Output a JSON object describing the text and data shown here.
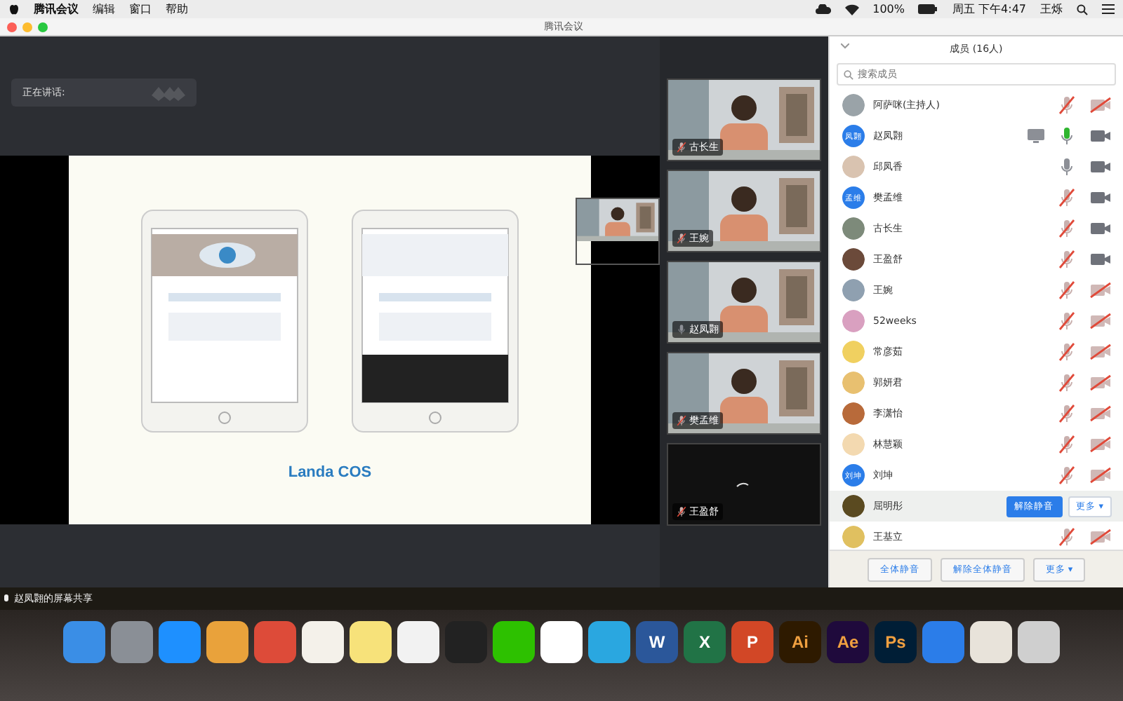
{
  "menu_bar": {
    "app": "腾讯会议",
    "items": [
      "编辑",
      "窗口",
      "帮助"
    ],
    "battery": "100%",
    "clock": "周五 下午4:47",
    "user": "王烁"
  },
  "window": {
    "title": "腾讯会议"
  },
  "speaking": {
    "label": "正在讲话:"
  },
  "slide": {
    "title": "Landa COS"
  },
  "videos": [
    {
      "name": "古长生",
      "muted": true
    },
    {
      "name": "王婉",
      "muted": true
    },
    {
      "name": "赵凤翾",
      "muted": false
    },
    {
      "name": "樊孟维",
      "muted": true
    },
    {
      "name": "王盈舒",
      "muted": true
    }
  ],
  "share_status": "赵凤翾的屏幕共享",
  "panel": {
    "title": "成员 (16人)",
    "search": {
      "placeholder": "搜索成员"
    },
    "members": [
      {
        "name": "阿萨咪(主持人)",
        "avatar": {
          "kind": "picture",
          "color": "#9aa3a8"
        },
        "sharing": false,
        "muted": true,
        "speaking": false,
        "camera": false,
        "selected": false
      },
      {
        "name": "赵凤翾",
        "avatar": {
          "kind": "text",
          "text": "凤翾",
          "color": "#2b7de9"
        },
        "sharing": true,
        "muted": false,
        "speaking": true,
        "camera": true,
        "selected": false
      },
      {
        "name": "邱凤香",
        "avatar": {
          "kind": "picture",
          "color": "#d9c3b0"
        },
        "sharing": false,
        "muted": false,
        "speaking": false,
        "camera": true,
        "selected": false
      },
      {
        "name": "樊孟维",
        "avatar": {
          "kind": "text",
          "text": "孟维",
          "color": "#2b7de9"
        },
        "sharing": false,
        "muted": true,
        "speaking": false,
        "camera": true,
        "selected": false
      },
      {
        "name": "古长生",
        "avatar": {
          "kind": "picture",
          "color": "#7d8a7a"
        },
        "sharing": false,
        "muted": true,
        "speaking": false,
        "camera": true,
        "selected": false
      },
      {
        "name": "王盈舒",
        "avatar": {
          "kind": "picture",
          "color": "#6b4a3a"
        },
        "sharing": false,
        "muted": true,
        "speaking": false,
        "camera": true,
        "selected": false
      },
      {
        "name": "王婉",
        "avatar": {
          "kind": "picture",
          "color": "#8fa0b0"
        },
        "sharing": false,
        "muted": true,
        "speaking": false,
        "camera": false,
        "selected": false
      },
      {
        "name": "52weeks",
        "avatar": {
          "kind": "picture",
          "color": "#d9a0c0"
        },
        "sharing": false,
        "muted": true,
        "speaking": false,
        "camera": false,
        "selected": false
      },
      {
        "name": "常彦茹",
        "avatar": {
          "kind": "picture",
          "color": "#f0d060"
        },
        "sharing": false,
        "muted": true,
        "speaking": false,
        "camera": false,
        "selected": false
      },
      {
        "name": "郭妍君",
        "avatar": {
          "kind": "picture",
          "color": "#e8c070"
        },
        "sharing": false,
        "muted": true,
        "speaking": false,
        "camera": false,
        "selected": false
      },
      {
        "name": "李潇怡",
        "avatar": {
          "kind": "picture",
          "color": "#b86a3a"
        },
        "sharing": false,
        "muted": true,
        "speaking": false,
        "camera": false,
        "selected": false
      },
      {
        "name": "林慧颖",
        "avatar": {
          "kind": "picture",
          "color": "#f3d9b0"
        },
        "sharing": false,
        "muted": true,
        "speaking": false,
        "camera": false,
        "selected": false
      },
      {
        "name": "刘坤",
        "avatar": {
          "kind": "text",
          "text": "刘坤",
          "color": "#2b7de9"
        },
        "sharing": false,
        "muted": true,
        "speaking": false,
        "camera": false,
        "selected": false
      },
      {
        "name": "屈明彤",
        "avatar": {
          "kind": "picture",
          "color": "#5a4a20"
        },
        "selected": true,
        "actions": [
          "解除静音",
          "更多 ▾"
        ]
      },
      {
        "name": "王基立",
        "avatar": {
          "kind": "picture",
          "color": "#e0c060"
        },
        "sharing": false,
        "muted": true,
        "speaking": false,
        "camera": false,
        "selected": false
      }
    ],
    "buttons": [
      "全体静音",
      "解除全体静音",
      "更多 ▾"
    ]
  },
  "dock": [
    {
      "color": "#3a8ee6"
    },
    {
      "color": "#8a8f96"
    },
    {
      "color": "#1e90ff"
    },
    {
      "color": "#e9a23b"
    },
    {
      "color": "#dd4b39"
    },
    {
      "color": "#f4f1ea"
    },
    {
      "color": "#f7e27a"
    },
    {
      "color": "#f2f2f2"
    },
    {
      "color": "#222222"
    },
    {
      "color": "#2dc100"
    },
    {
      "color": "#ffffff"
    },
    {
      "color": "#2aa7e0"
    },
    {
      "color": "#2b579a",
      "label": "W"
    },
    {
      "color": "#217346",
      "label": "X"
    },
    {
      "color": "#d24726",
      "label": "P"
    },
    {
      "color": "#2e1a00",
      "label": "Ai"
    },
    {
      "color": "#1f0a3c",
      "label": "Ae"
    },
    {
      "color": "#001e36",
      "label": "Ps"
    },
    {
      "color": "#2b7de9"
    },
    {
      "color": "#e8e3da"
    },
    {
      "color": "#cfcfcf"
    }
  ]
}
